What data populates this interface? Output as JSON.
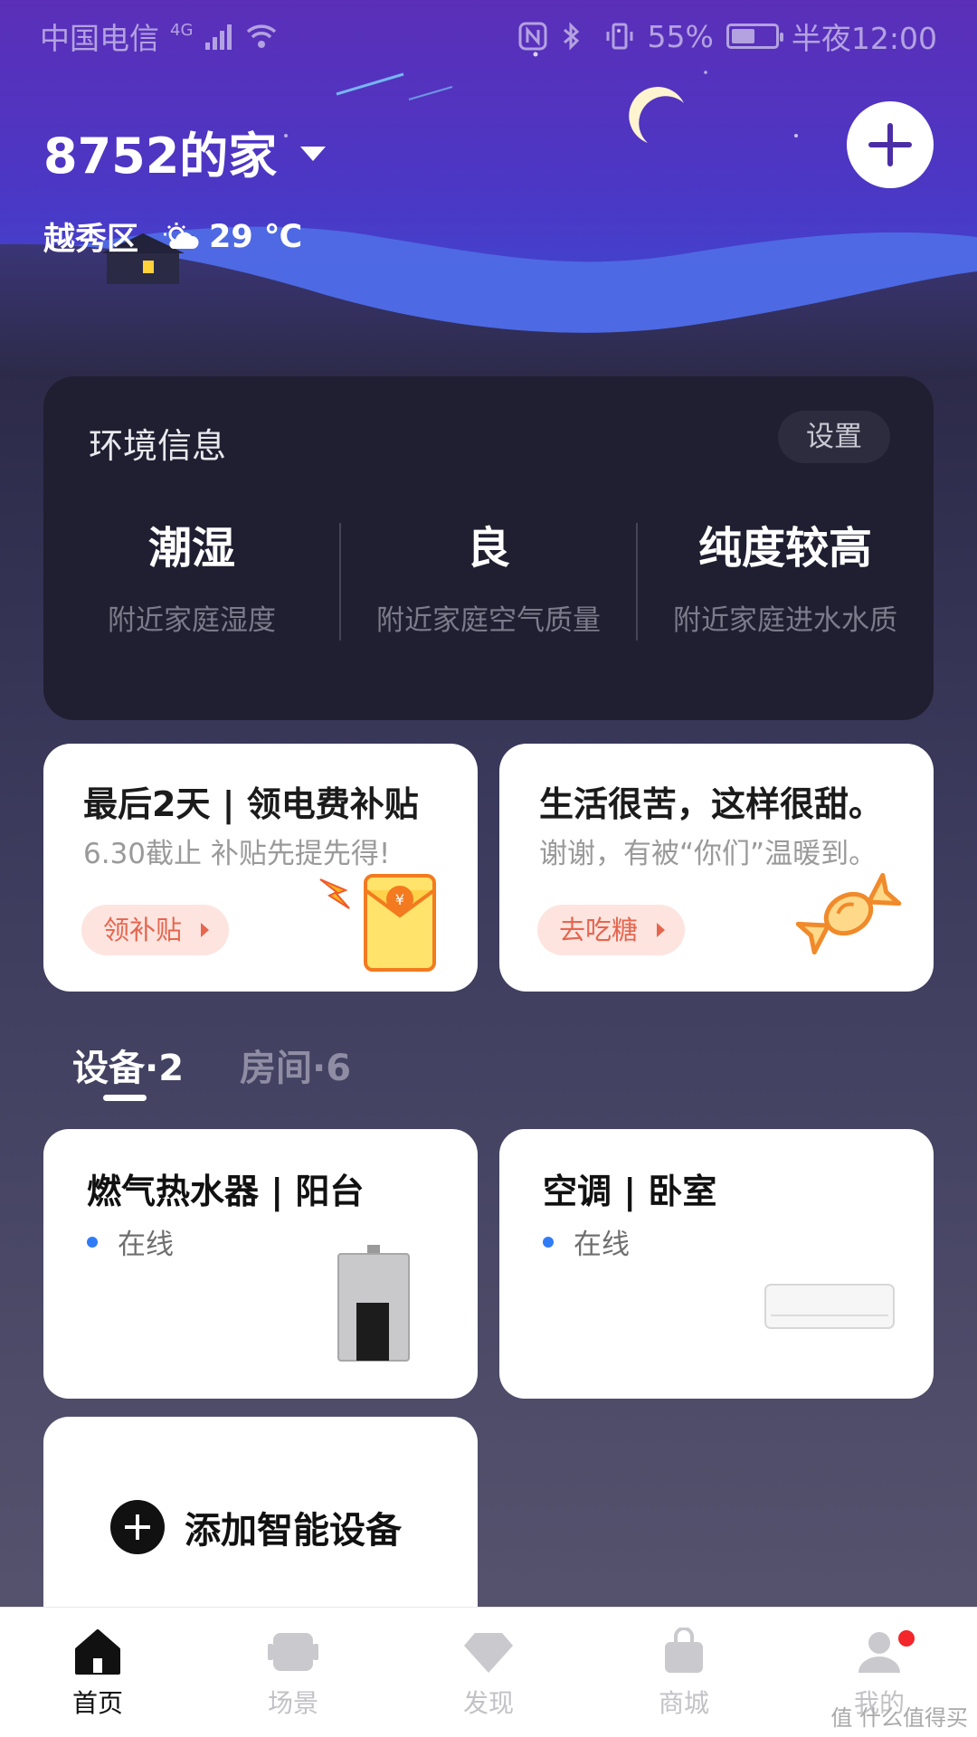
{
  "status_bar": {
    "carrier": "中国电信",
    "network": "4G",
    "battery_percent": "55%",
    "battery_level": 0.55,
    "time": "半夜12:00"
  },
  "header": {
    "home_name": "8752的家",
    "district": "越秀区",
    "temperature": "29 ℃",
    "weather_icon": "partly-cloudy-icon"
  },
  "environment": {
    "title": "环境信息",
    "setting_label": "设置",
    "metrics": [
      {
        "value": "潮湿",
        "label": "附近家庭湿度"
      },
      {
        "value": "良",
        "label": "附近家庭空气质量"
      },
      {
        "value": "纯度较高",
        "label": "附近家庭进水水质"
      }
    ]
  },
  "promos": [
    {
      "title": "最后2天 | 领电费补贴",
      "subtitle": "6.30截止 补贴先提先得!",
      "button": "领补贴"
    },
    {
      "title": "生活很苦，这样很甜。",
      "subtitle": "谢谢，有被“你们”温暖到。",
      "button": "去吃糖"
    }
  ],
  "tabs": [
    {
      "label": "设备·2",
      "active": true
    },
    {
      "label": "房间·6",
      "active": false
    }
  ],
  "devices": [
    {
      "name": "燃气热水器 | 阳台",
      "status": "在线"
    },
    {
      "name": "空调 | 卧室",
      "status": "在线"
    }
  ],
  "add_device": {
    "label": "添加智能设备"
  },
  "bottom_nav": [
    {
      "label": "首页",
      "icon": "home-icon",
      "active": true
    },
    {
      "label": "场景",
      "icon": "scene-icon",
      "active": false
    },
    {
      "label": "发现",
      "icon": "discover-icon",
      "active": false
    },
    {
      "label": "商城",
      "icon": "shop-icon",
      "active": false
    },
    {
      "label": "我的",
      "icon": "profile-icon",
      "active": false
    }
  ],
  "watermark": "值 什么值得买",
  "colors": {
    "accent_purple": "#4b2ea5",
    "status_blue": "#2f7cf6",
    "promo_orange": "#e5664f",
    "badge_red": "#f2262b"
  }
}
